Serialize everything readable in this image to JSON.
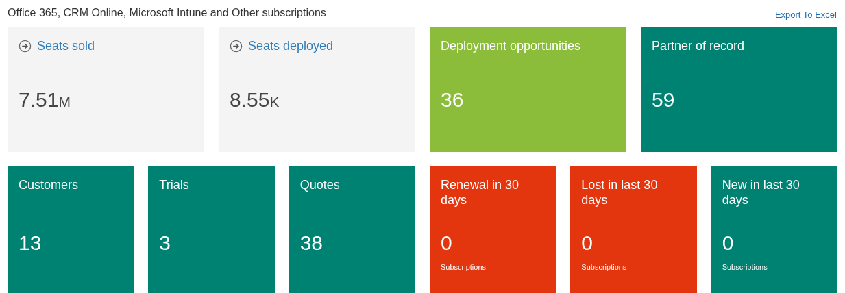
{
  "header": {
    "title": "Office 365, CRM Online, Microsoft Intune and Other subscriptions",
    "export_link": "Export To Excel"
  },
  "top_tiles": [
    {
      "kind": "link",
      "label": "Seats sold",
      "value": "7.51",
      "unit": "M",
      "color": "#f4f4f4"
    },
    {
      "kind": "link",
      "label": "Seats deployed",
      "value": "8.55",
      "unit": "K",
      "color": "#f4f4f4"
    },
    {
      "kind": "count",
      "label": "Deployment opportunities",
      "value": "36",
      "color": "#8cbd3a"
    },
    {
      "kind": "count",
      "label": "Partner of record",
      "value": "59",
      "color": "#008272"
    }
  ],
  "bottom_tiles": [
    {
      "label": "Customers",
      "value": "13",
      "color": "#008272"
    },
    {
      "label": "Trials",
      "value": "3",
      "color": "#008272"
    },
    {
      "label": "Quotes",
      "value": "38",
      "color": "#008272"
    },
    {
      "label": "Renewal in 30 days",
      "value": "0",
      "caption": "Subscriptions",
      "color": "#e3360f"
    },
    {
      "label": "Lost in last 30 days",
      "value": "0",
      "caption": "Subscriptions",
      "color": "#e3360f"
    },
    {
      "label": "New in last 30 days",
      "value": "0",
      "caption": "Subscriptions",
      "color": "#008272"
    }
  ]
}
